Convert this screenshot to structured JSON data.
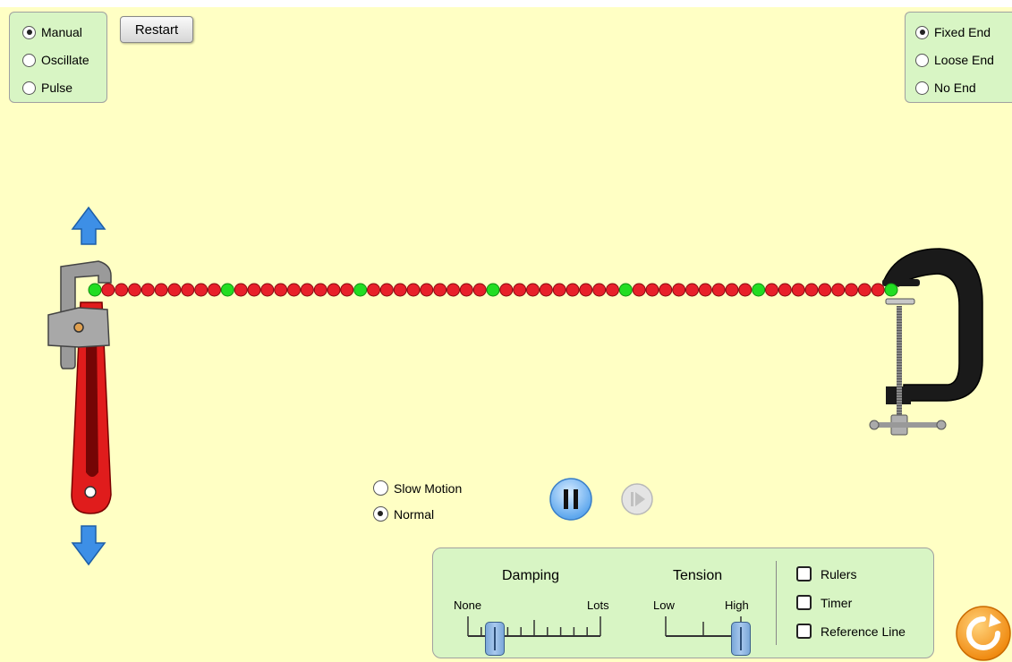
{
  "mode": {
    "options": [
      {
        "label": "Manual",
        "selected": true
      },
      {
        "label": "Oscillate",
        "selected": false
      },
      {
        "label": "Pulse",
        "selected": false
      }
    ]
  },
  "toolbar": {
    "restart_label": "Restart"
  },
  "end": {
    "options": [
      {
        "label": "Fixed End",
        "selected": true
      },
      {
        "label": "Loose End",
        "selected": false
      },
      {
        "label": "No End",
        "selected": false
      }
    ]
  },
  "speed": {
    "options": [
      {
        "label": "Slow Motion",
        "selected": false
      },
      {
        "label": "Normal",
        "selected": true
      }
    ]
  },
  "playback": {
    "state": "playing"
  },
  "settings": {
    "damping": {
      "title": "Damping",
      "min_label": "None",
      "max_label": "Lots",
      "value": 0.2
    },
    "tension": {
      "title": "Tension",
      "min_label": "Low",
      "max_label": "High",
      "value": 1.0
    },
    "checkboxes": [
      {
        "label": "Rulers",
        "checked": false
      },
      {
        "label": "Timer",
        "checked": false
      },
      {
        "label": "Reference Line",
        "checked": false
      }
    ]
  },
  "string": {
    "bead_count": 61,
    "green_every": 10
  },
  "colors": {
    "background": "#ffffc4",
    "panel": "#d8f5c4",
    "bead_red": "#e8202a",
    "bead_green": "#22dd22",
    "arrow_blue": "#3d8fe6",
    "reset_orange": "#f39a1b"
  },
  "icons": {
    "up": "up-arrow-icon",
    "down": "down-arrow-icon",
    "pause": "pause-icon",
    "step": "step-forward-icon",
    "reset": "reset-icon"
  }
}
